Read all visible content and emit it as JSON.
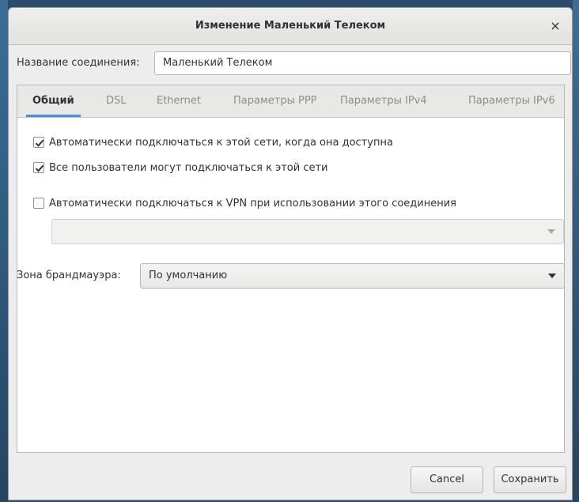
{
  "window": {
    "title": "Изменение Маленький Телеком",
    "close_glyph": "×"
  },
  "connection": {
    "name_label": "Название соединения:",
    "name_value": "Маленький Телеком"
  },
  "tabs": [
    {
      "label": "Общий",
      "active": true
    },
    {
      "label": "DSL",
      "active": false
    },
    {
      "label": "Ethernet",
      "active": false
    },
    {
      "label": "Параметры PPP",
      "active": false
    },
    {
      "label": "Параметры IPv4",
      "active": false
    },
    {
      "label": "Параметры IPv6",
      "active": false
    }
  ],
  "general": {
    "auto_connect": {
      "label": "Автоматически подключаться к этой сети, когда она доступна",
      "checked": true
    },
    "all_users": {
      "label": "Все пользователи могут подключаться к этой сети",
      "checked": true
    },
    "auto_vpn": {
      "label": "Автоматически подключаться к VPN при использовании этого соединения",
      "checked": false
    },
    "vpn_select": {
      "value": "",
      "enabled": false
    },
    "firewall_zone": {
      "label": "Зона брандмауэра:",
      "value": "По умолчанию"
    }
  },
  "buttons": {
    "cancel": "Cancel",
    "save": "Сохранить"
  },
  "icons": {
    "close": "close-icon",
    "checkmark": "checkmark-icon",
    "dropdown": "chevron-down-icon"
  },
  "colors": {
    "accent": "#4a90d9",
    "desktop": "#2b4d6a"
  }
}
